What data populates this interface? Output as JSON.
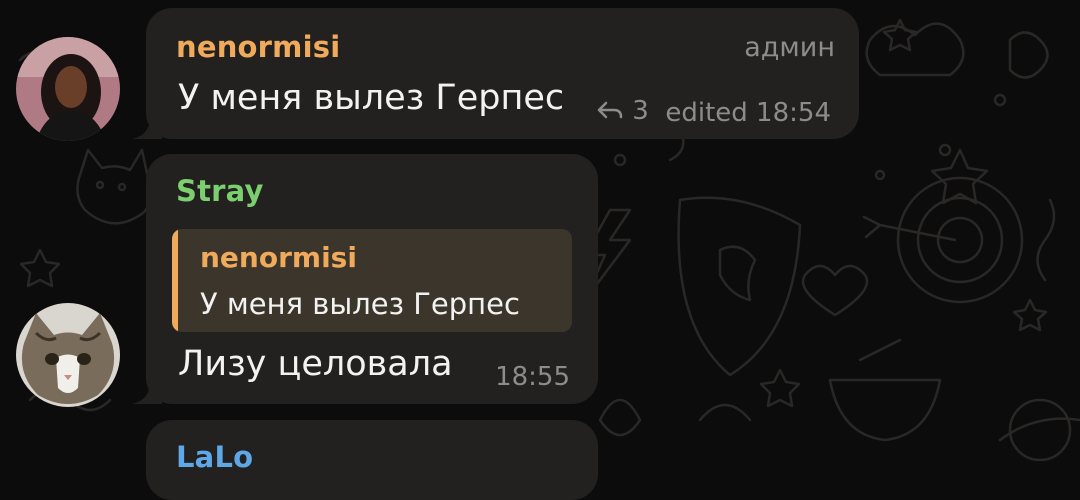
{
  "colors": {
    "background": "#0c0c0c",
    "bubble": "#222120",
    "sender_orange": "#f0aa5c",
    "sender_green": "#7ccf6e",
    "sender_blue": "#5fa8e8",
    "meta_gray": "#8d8c8a",
    "reply_background": "#3c352c"
  },
  "messages": [
    {
      "sender": "nenormisi",
      "sender_color": "#f0aa5c",
      "role": "админ",
      "text": "У меня вылез Герпес",
      "replies_icon": "reply-arrow-icon",
      "replies_count": "3",
      "edited_time": "edited 18:54",
      "avatar": "avatar-woman-photo"
    },
    {
      "sender": "Stray",
      "sender_color": "#7ccf6e",
      "reply_to": {
        "sender": "nenormisi",
        "text": "У меня вылез Герпес"
      },
      "text": "Лизу целовала",
      "time": "18:55",
      "avatar": "avatar-cat-photo"
    },
    {
      "sender": "LaLo",
      "sender_color": "#5fa8e8"
    }
  ]
}
